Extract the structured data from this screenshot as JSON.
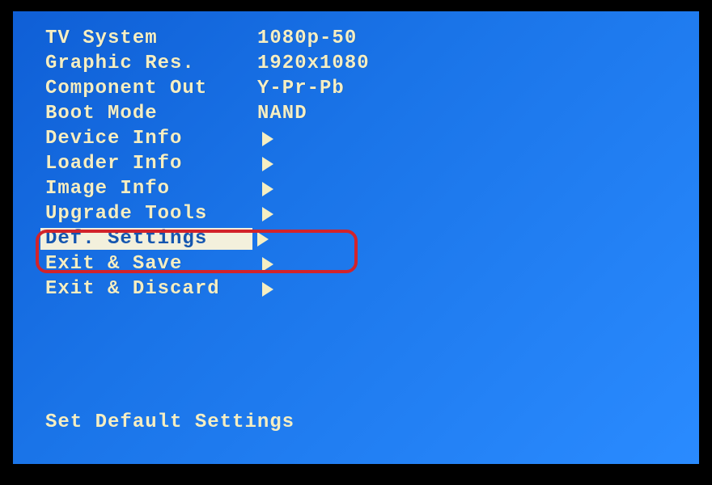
{
  "menu": {
    "items": [
      {
        "label": "TV System",
        "value": "1080p-50",
        "submenu": false
      },
      {
        "label": "Graphic Res.",
        "value": "1920x1080",
        "submenu": false
      },
      {
        "label": "Component Out",
        "value": "Y-Pr-Pb",
        "submenu": false
      },
      {
        "label": "Boot Mode",
        "value": "NAND",
        "submenu": false
      },
      {
        "label": "Device Info",
        "value": "",
        "submenu": true
      },
      {
        "label": "Loader Info",
        "value": "",
        "submenu": true
      },
      {
        "label": "Image Info",
        "value": "",
        "submenu": true
      },
      {
        "label": "Upgrade Tools",
        "value": "",
        "submenu": true
      },
      {
        "label": "Def. Settings",
        "value": "",
        "submenu": true,
        "selected": true
      },
      {
        "label": "Exit & Save",
        "value": "",
        "submenu": true
      },
      {
        "label": "Exit & Discard",
        "value": "",
        "submenu": true
      }
    ]
  },
  "status_text": "Set Default Settings",
  "annotation": {
    "highlighted_index": 8
  }
}
